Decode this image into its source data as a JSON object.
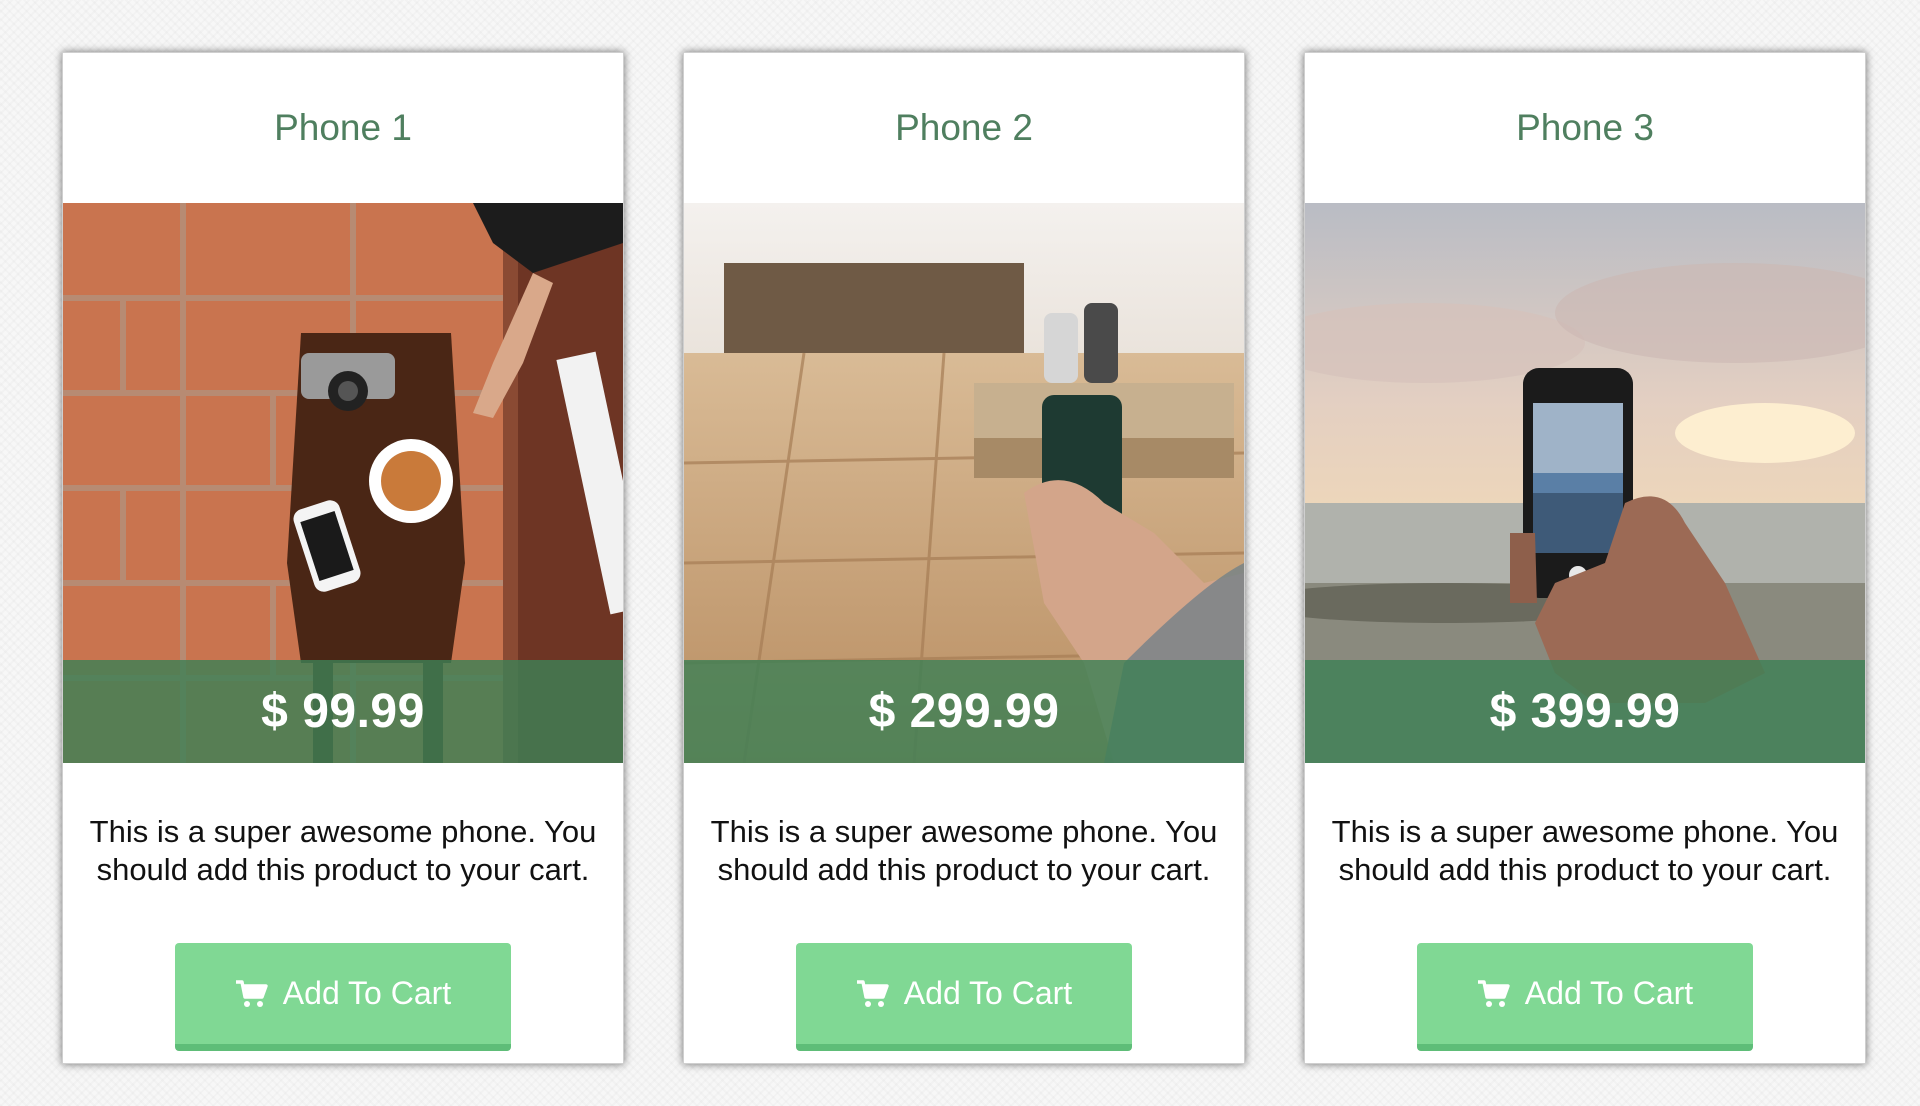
{
  "products": [
    {
      "title": "Phone 1",
      "price": "$ 99.99",
      "description": "This is a super awesome phone. You should add this product to your cart.",
      "button_label": "Add To Cart",
      "button_icon": "shopping-cart-icon"
    },
    {
      "title": "Phone 2",
      "price": "$ 299.99",
      "description": "This is a super awesome phone. You should add this product to your cart.",
      "button_label": "Add To Cart",
      "button_icon": "shopping-cart-icon"
    },
    {
      "title": "Phone 3",
      "price": "$ 399.99",
      "description": "This is a super awesome phone. You should add this product to your cart.",
      "button_label": "Add To Cart",
      "button_icon": "shopping-cart-icon"
    }
  ],
  "colors": {
    "title_green": "#4f7f5f",
    "price_band": "#3e8056",
    "button_green": "#80d894",
    "button_shadow": "#5ebd78"
  }
}
